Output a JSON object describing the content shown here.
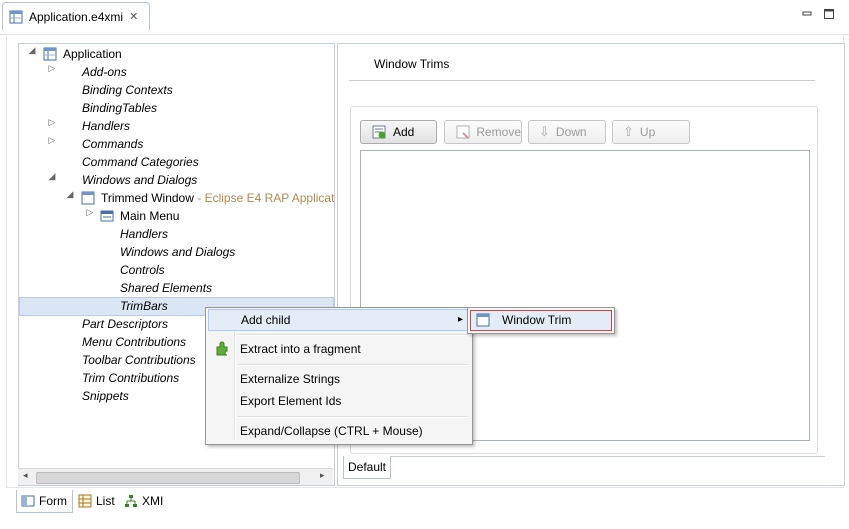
{
  "editor_tab": {
    "title": "Application.e4xmi",
    "close": "✕"
  },
  "window_controls": {
    "minimize": "minimize-icon",
    "maximize": "maximize-icon"
  },
  "tree": {
    "root": "Application",
    "items": [
      {
        "label": "Add-ons",
        "expandable": true
      },
      {
        "label": "Binding Contexts",
        "expandable": false
      },
      {
        "label": "BindingTables",
        "expandable": false
      },
      {
        "label": "Handlers",
        "expandable": true
      },
      {
        "label": "Commands",
        "expandable": true
      },
      {
        "label": "Command Categories",
        "expandable": false
      },
      {
        "label": "Windows and Dialogs",
        "expanded": true
      },
      {
        "label": "Trimmed Window",
        "suffix": " - Eclipse E4 RAP Applicat",
        "expanded": true
      },
      {
        "label": "Main Menu",
        "expandable": true
      },
      {
        "label": "Handlers"
      },
      {
        "label": "Windows and Dialogs"
      },
      {
        "label": "Controls"
      },
      {
        "label": "Shared Elements"
      },
      {
        "label": "TrimBars",
        "selected": true
      },
      {
        "label": "Part Descriptors"
      },
      {
        "label": "Menu Contributions"
      },
      {
        "label": "Toolbar Contributions"
      },
      {
        "label": "Trim Contributions"
      },
      {
        "label": "Snippets"
      }
    ]
  },
  "details": {
    "title": "Window Trims",
    "buttons": {
      "add": "Add",
      "remove": "Remove",
      "down": "Down",
      "up": "Up"
    },
    "tab": "Default"
  },
  "context_menu": {
    "add_child": "Add child",
    "extract": "Extract into a fragment",
    "externalize": "Externalize Strings",
    "export_ids": "Export Element Ids",
    "expand_collapse": "Expand/Collapse (CTRL + Mouse)",
    "submenu_arrow": "▸"
  },
  "submenu": {
    "window_trim": "Window Trim"
  },
  "bottom_tabs": {
    "form": "Form",
    "list": "List",
    "xmi": "XMI"
  },
  "colors": {
    "selection": "#dbe6f5",
    "suffix": "#b08a4f",
    "submenu_border": "#c64a4a"
  }
}
